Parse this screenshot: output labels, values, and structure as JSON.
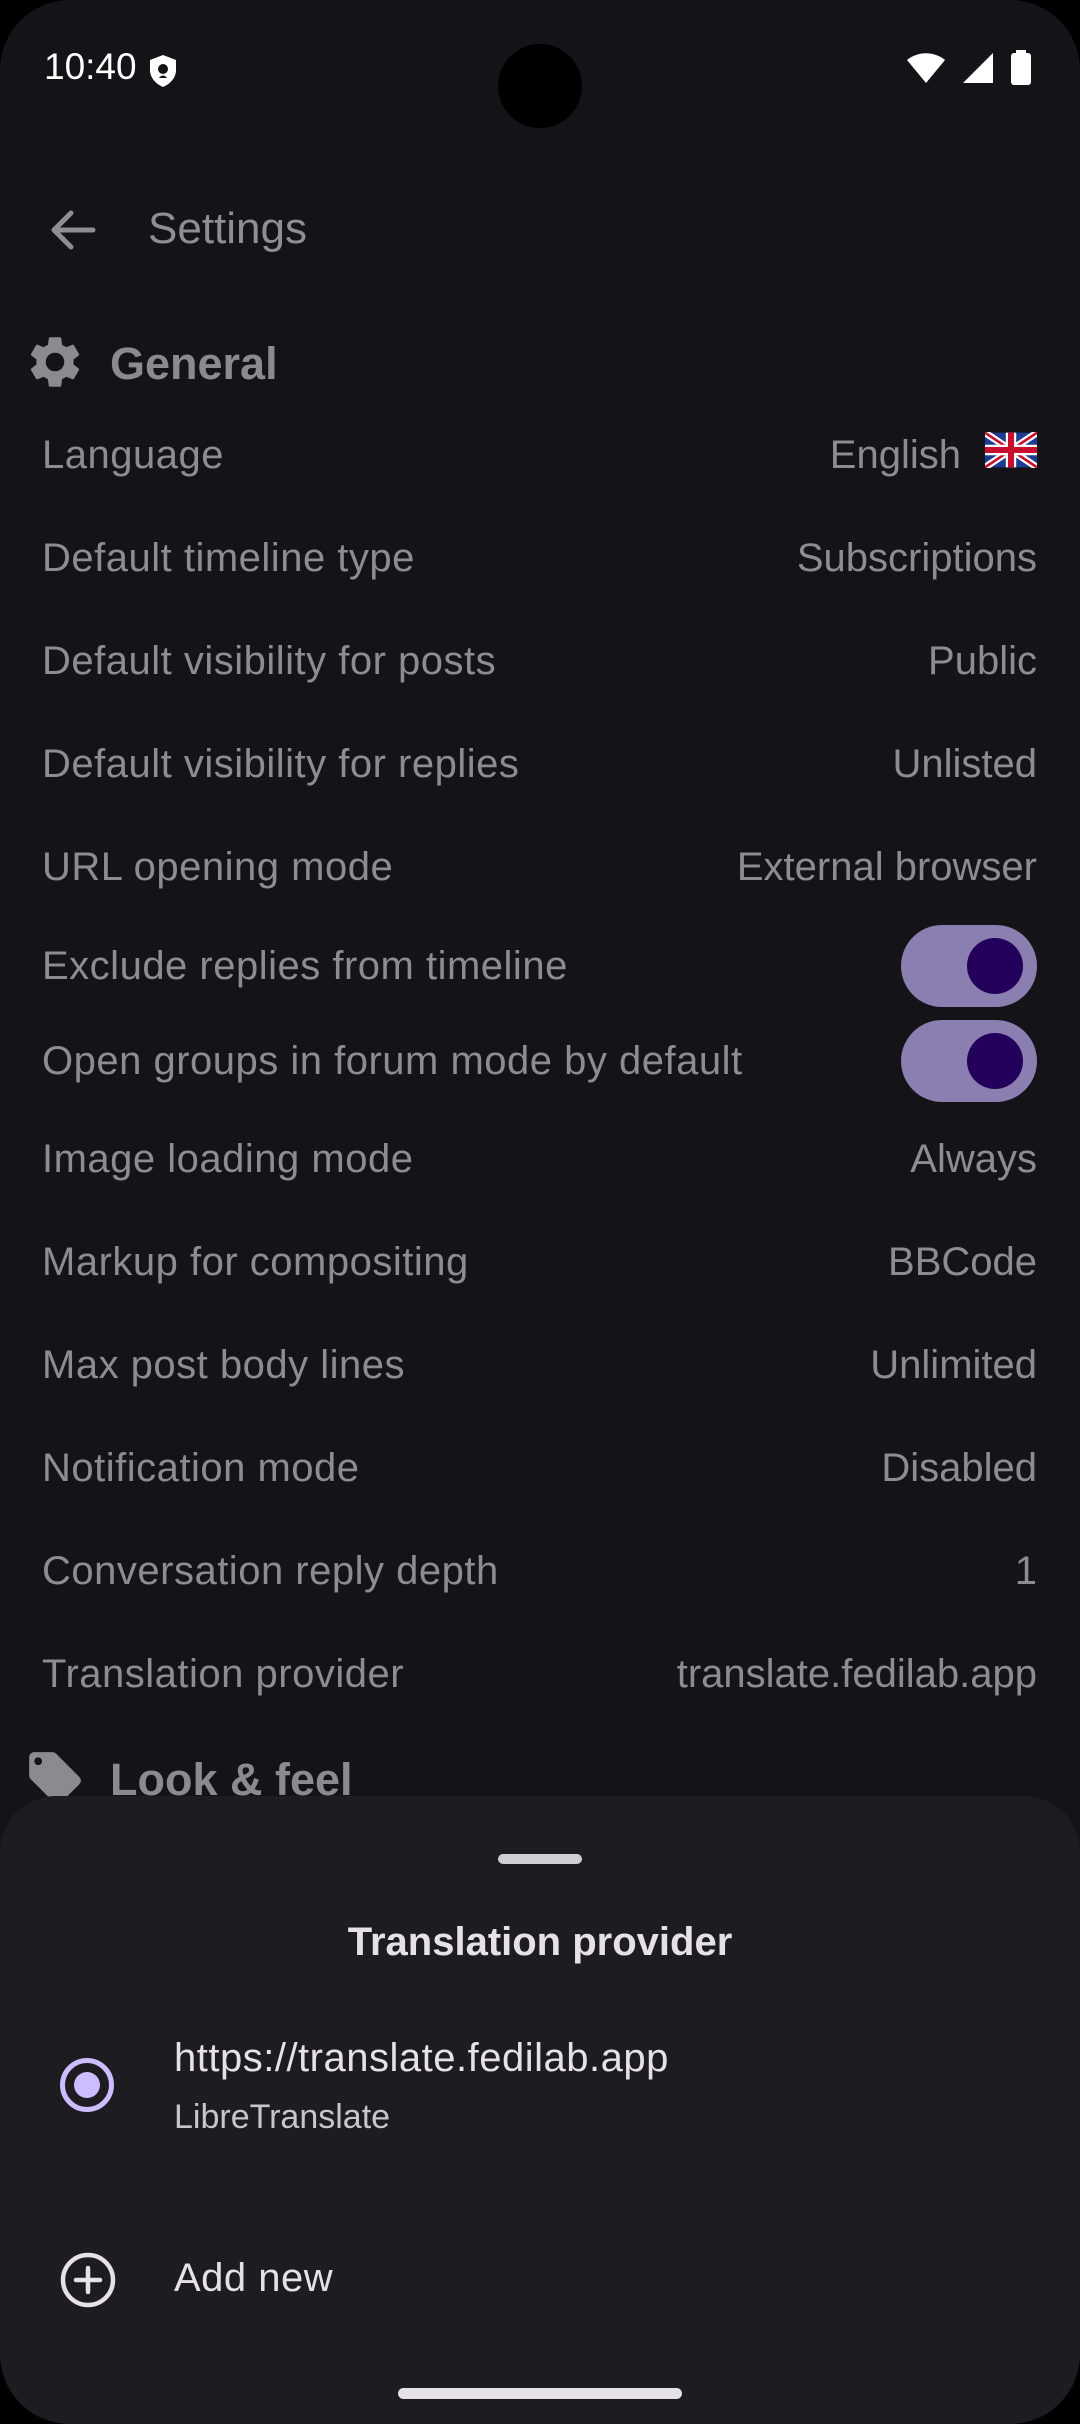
{
  "status": {
    "time": "10:40"
  },
  "appbar": {
    "title": "Settings"
  },
  "sections": {
    "general": "General",
    "look_feel": "Look & feel"
  },
  "settings": [
    {
      "label": "Language",
      "value": "English",
      "flag": "uk-flag"
    },
    {
      "label": "Default timeline type",
      "value": "Subscriptions"
    },
    {
      "label": "Default visibility for posts",
      "value": "Public"
    },
    {
      "label": "Default visibility for replies",
      "value": "Unlisted"
    },
    {
      "label": "URL opening mode",
      "value": "External browser"
    },
    {
      "label": "Exclude replies from timeline",
      "toggle": true
    },
    {
      "label": "Open groups in forum mode by default",
      "toggle": true
    },
    {
      "label": "Image loading mode",
      "value": "Always"
    },
    {
      "label": "Markup for compositing",
      "value": "BBCode"
    },
    {
      "label": "Max post body lines",
      "value": "Unlimited"
    },
    {
      "label": "Notification mode",
      "value": "Disabled"
    },
    {
      "label": "Conversation reply depth",
      "value": "1"
    },
    {
      "label": "Translation provider",
      "value": "translate.fedilab.app"
    }
  ],
  "sheet": {
    "title": "Translation provider",
    "option": {
      "url": "https://translate.fedilab.app",
      "type": "LibreTranslate",
      "selected": true
    },
    "add_label": "Add new"
  },
  "colors": {
    "background": "#141317",
    "sheet": "#1d1c21",
    "accent": "#cdbdff",
    "toggle_track": "#8a7fb0",
    "toggle_knob": "#23005c"
  },
  "icons": [
    "back-arrow-icon",
    "gear-icon",
    "tag-icon",
    "add-circle-icon",
    "wifi-icon",
    "signal-icon",
    "battery-icon",
    "shield-icon"
  ]
}
